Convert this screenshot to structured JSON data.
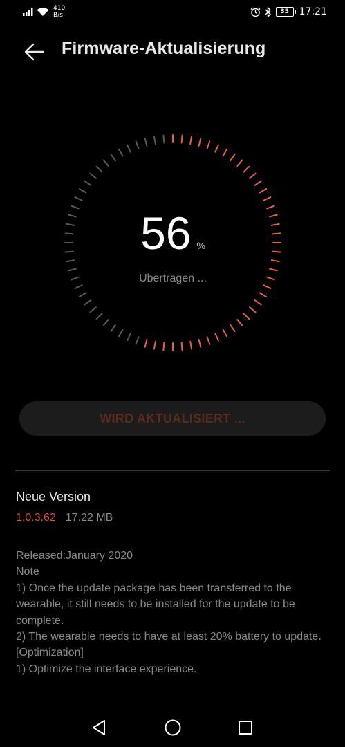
{
  "status_bar": {
    "net_speed_value": "410",
    "net_speed_unit": "B/s",
    "battery": "35",
    "time": "17:21"
  },
  "header": {
    "title": "Firmware-Aktualisierung",
    "back_icon": "arrow-left-icon"
  },
  "progress": {
    "percent": 56,
    "value_text": "56",
    "unit": "%",
    "status": "Übertragen ...",
    "active_color": "#e8603c",
    "inactive_color": "#5a5a5a"
  },
  "update_button": {
    "label": "WIRD AKTUALISIERT ..."
  },
  "version": {
    "heading": "Neue Version",
    "number": "1.0.3.62",
    "size": "17.22 MB"
  },
  "notes": [
    "Released:January 2020",
    "Note",
    "1) Once the update package has been transferred to the wearable, it still needs to be installed for the update to be complete.",
    "2) The wearable needs to have at least 20% battery to update.",
    "[Optimization]",
    "1) Optimize the interface experience."
  ],
  "nav_bar": {
    "back": "triangle-back-icon",
    "home": "circle-home-icon",
    "recents": "square-recents-icon"
  },
  "colors": {
    "background": "#000000",
    "accent": "#e24a3b"
  }
}
